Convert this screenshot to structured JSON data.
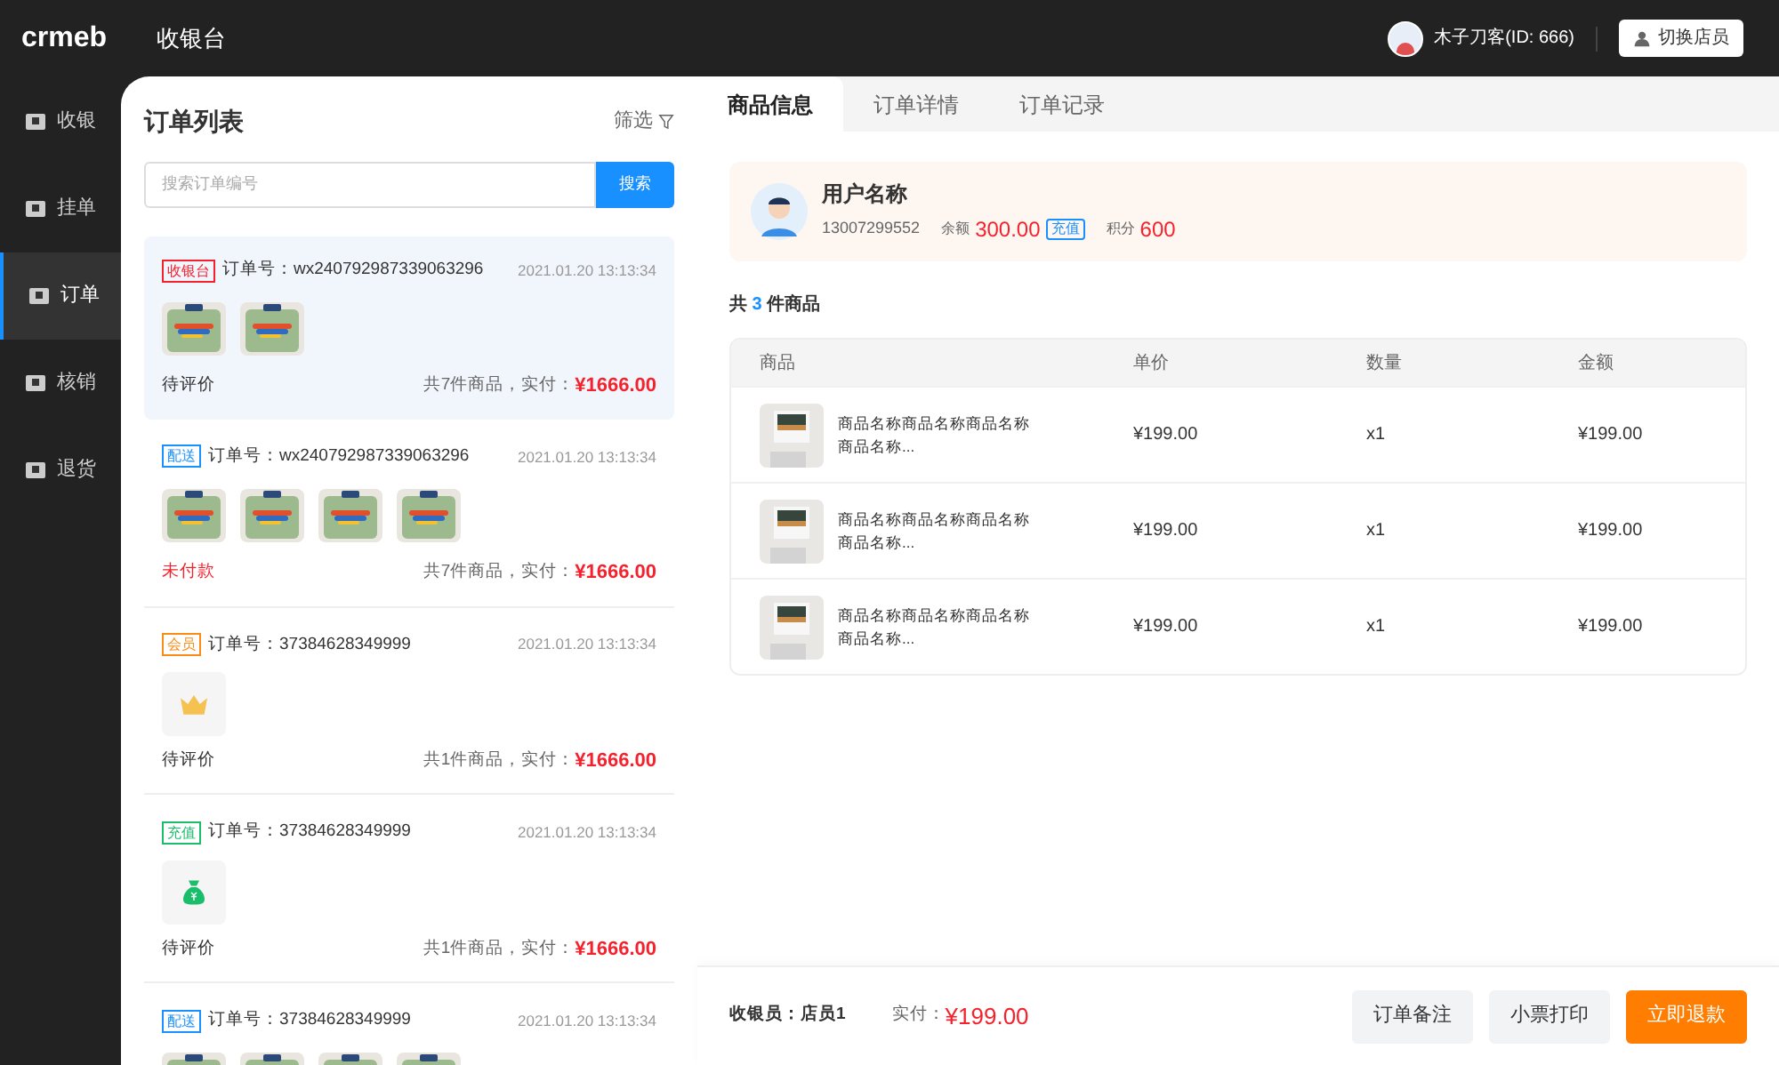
{
  "header": {
    "logo": "crmeb",
    "title": "收银台",
    "user": "木子刀客(ID: 666)",
    "switch_button": "切换店员"
  },
  "sidebar": {
    "items": [
      {
        "label": "收银",
        "selected": false
      },
      {
        "label": "挂单",
        "selected": false
      },
      {
        "label": "订单",
        "selected": true
      },
      {
        "label": "核销",
        "selected": false
      },
      {
        "label": "退货",
        "selected": false
      }
    ]
  },
  "order_list": {
    "title": "订单列表",
    "filter": "筛选",
    "search": {
      "placeholder": "搜索订单编号",
      "button": "搜索"
    },
    "orders": [
      {
        "tag": "收银台",
        "kind": "cashier",
        "number": "订单号：wx240792987339063296",
        "time": "2021.01.20 13:13:34",
        "status": "待评价",
        "unpaid": false,
        "summary": "共7件商品，实付：",
        "amount": "¥1666.00",
        "selected": true
      },
      {
        "tag": "配送",
        "kind": "delivery",
        "number": "订单号：wx240792987339063296",
        "time": "2021.01.20 13:13:34",
        "status": "未付款",
        "unpaid": true,
        "summary": "共7件商品，实付：",
        "amount": "¥1666.00",
        "selected": false
      },
      {
        "tag": "会员",
        "kind": "member",
        "number": "订单号：37384628349999",
        "time": "2021.01.20 13:13:34",
        "items": [
          {
            "kind": "crown"
          }
        ],
        "status": "待评价",
        "unpaid": false,
        "summary": "共1件商品，实付：",
        "amount": "¥1666.00",
        "selected": false
      },
      {
        "tag": "充值",
        "kind": "recharge",
        "number": "订单号：37384628349999",
        "time": "2021.01.20 13:13:34",
        "items": [
          {
            "kind": "moneybag"
          }
        ],
        "status": "待评价",
        "unpaid": false,
        "summary": "共1件商品，实付：",
        "amount": "¥1666.00",
        "selected": false
      },
      {
        "tag": "配送",
        "kind": "delivery",
        "number": "订单号：37384628349999",
        "time": "2021.01.20 13:13:34",
        "selected": false
      }
    ]
  },
  "tabs": [
    {
      "label": "商品信息",
      "selected": true
    },
    {
      "label": "订单详情",
      "selected": false
    },
    {
      "label": "订单记录",
      "selected": false
    }
  ],
  "customer": {
    "name": "用户名称",
    "phone": "13007299552",
    "balance_label": "余额",
    "balance": "300.00",
    "recharge": "充值",
    "points_label": "积分",
    "points": "600"
  },
  "count": {
    "prefix": "共",
    "value": "3",
    "suffix": "件商品"
  },
  "table": {
    "columns": [
      "商品",
      "单价",
      "数量",
      "金额"
    ],
    "rows": [
      {
        "name": "商品名称商品名称商品名称商品名称...",
        "price": "¥199.00",
        "qty": "x1",
        "total": "¥199.00"
      },
      {
        "name": "商品名称商品名称商品名称商品名称...",
        "price": "¥199.00",
        "qty": "x1",
        "total": "¥199.00"
      },
      {
        "name": "商品名称商品名称商品名称商品名称...",
        "price": "¥199.00",
        "qty": "x1",
        "total": "¥199.00"
      }
    ]
  },
  "footer": {
    "cashier_label": "收银员：",
    "cashier": "店员1",
    "paid_label": "实付：",
    "paid": "¥199.00",
    "buttons": [
      {
        "label": "订单备注",
        "kind": "secondary"
      },
      {
        "label": "小票打印",
        "kind": "secondary"
      },
      {
        "label": "立即退款",
        "kind": "primary"
      }
    ]
  }
}
